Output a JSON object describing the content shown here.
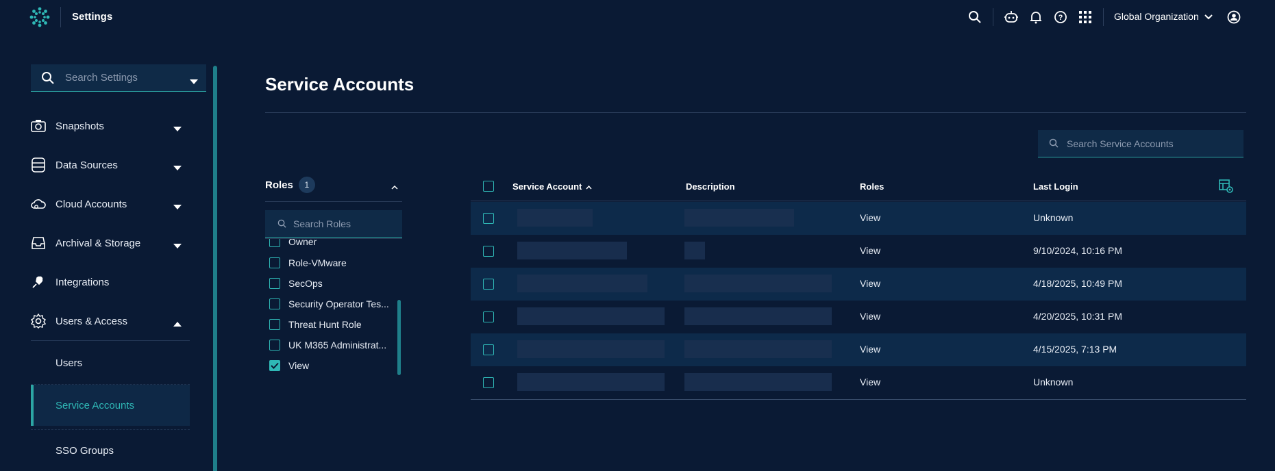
{
  "header": {
    "title": "Settings",
    "org_label": "Global Organization"
  },
  "sidebar": {
    "search_placeholder": "Search Settings",
    "items": [
      {
        "label": "Snapshots",
        "icon": "camera-icon"
      },
      {
        "label": "Data Sources",
        "icon": "database-icon"
      },
      {
        "label": "Cloud Accounts",
        "icon": "cloud-gear-icon"
      },
      {
        "label": "Archival & Storage",
        "icon": "archive-tray-icon"
      },
      {
        "label": "Integrations",
        "icon": "plug-icon"
      },
      {
        "label": "Users & Access",
        "icon": "gear-icon"
      }
    ],
    "sub_items": [
      {
        "label": "Users"
      },
      {
        "label": "Service Accounts"
      },
      {
        "label": "SSO Groups"
      }
    ]
  },
  "main": {
    "page_title": "Service Accounts",
    "search_placeholder": "Search Service Accounts",
    "roles_filter": {
      "heading": "Roles",
      "selected_count": "1",
      "search_placeholder": "Search Roles",
      "options": [
        {
          "label": "Owner",
          "checked": false
        },
        {
          "label": "Role-VMware",
          "checked": false
        },
        {
          "label": "SecOps",
          "checked": false
        },
        {
          "label": "Security Operator Tes...",
          "checked": false
        },
        {
          "label": "Threat Hunt Role",
          "checked": false
        },
        {
          "label": "UK M365 Administrat...",
          "checked": false
        },
        {
          "label": "View",
          "checked": true
        }
      ]
    },
    "table": {
      "columns": [
        "Service Account",
        "Description",
        "Roles",
        "Last Login"
      ],
      "rows": [
        {
          "roles": "View",
          "last_login": "Unknown"
        },
        {
          "roles": "View",
          "last_login": "9/10/2024, 10:16 PM"
        },
        {
          "roles": "View",
          "last_login": "4/18/2025, 10:49 PM"
        },
        {
          "roles": "View",
          "last_login": "4/20/2025, 10:31 PM"
        },
        {
          "roles": "View",
          "last_login": "4/15/2025, 7:13 PM"
        },
        {
          "roles": "View",
          "last_login": "Unknown"
        }
      ]
    }
  },
  "colors": {
    "background": "#0a1a34",
    "accent": "#2fb8b6",
    "row_shade": "#0d2a4a"
  }
}
